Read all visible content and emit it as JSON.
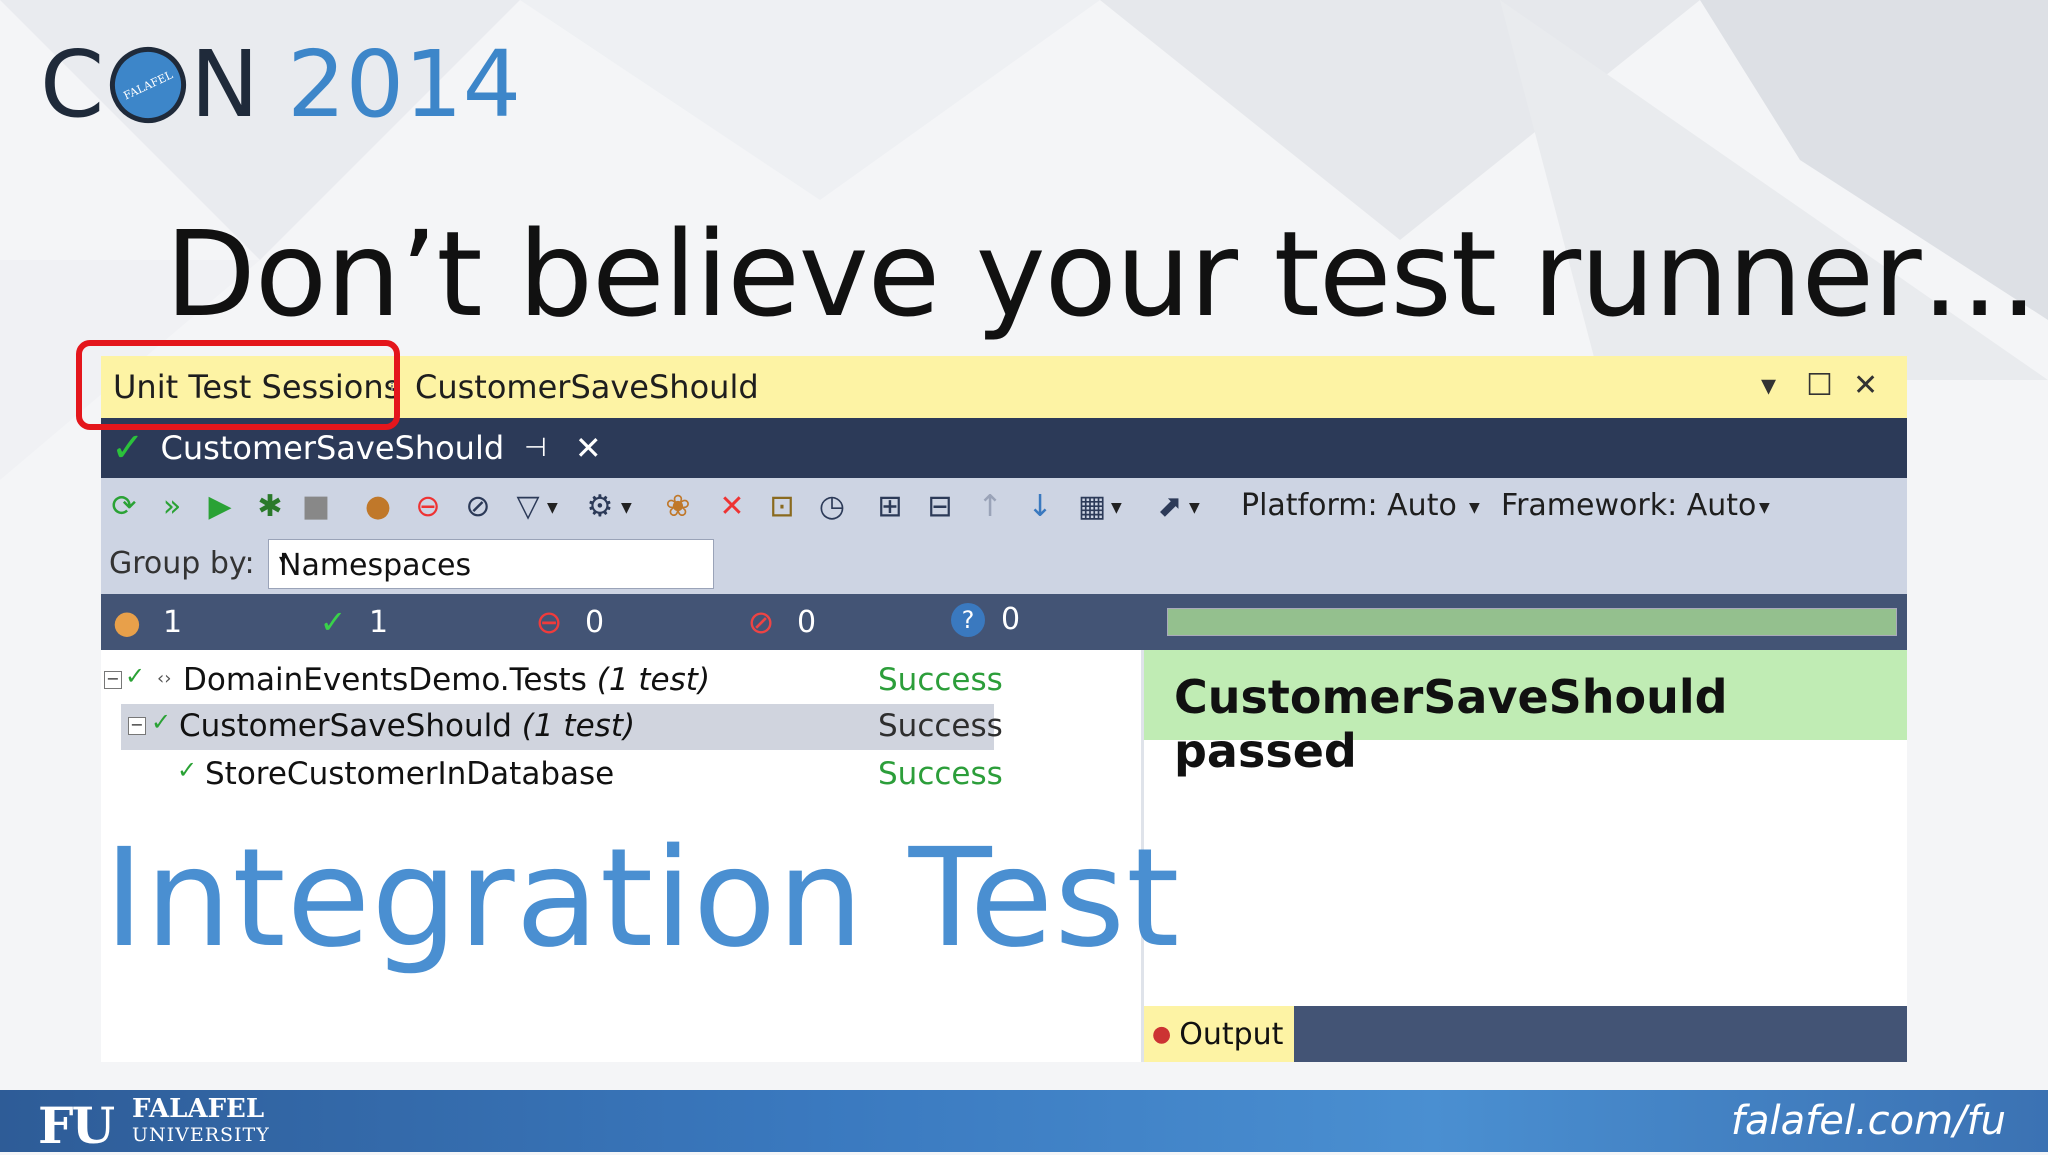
{
  "logo": {
    "c": "C",
    "ring_text": "FALAFEL",
    "n": "N",
    "year": "2014"
  },
  "slide": {
    "title": "Don’t believe your test runner…",
    "overlay": "Integration Test"
  },
  "window": {
    "title": "Unit Test Sessions",
    "session_name": "CustomerSaveShould",
    "controls": {
      "dropdown": "▾",
      "maximize": "☐",
      "close": "✕"
    }
  },
  "tab": {
    "label": "CustomerSaveShould",
    "pin": "⊣",
    "close": "✕"
  },
  "toolbar": {
    "platform": "Platform: Auto",
    "framework": "Framework: Auto",
    "icons": [
      "run-all-icon",
      "run-unit-tests-icon",
      "run-icon",
      "debug-icon",
      "stop-icon",
      "show-all-icon",
      "show-failed-icon",
      "hide-ignored-icon",
      "filter-icon",
      "build-icon",
      "dotcover-icon",
      "remove-icon",
      "lock-icon",
      "timer-icon",
      "expand-all-icon",
      "collapse-all-icon",
      "previous-icon",
      "next-icon",
      "layout-icon",
      "export-icon"
    ]
  },
  "group_by": {
    "label": "Group by:",
    "value": "Namespaces"
  },
  "status": {
    "total": "1",
    "passed": "1",
    "failed": "0",
    "ignored": "0",
    "unknown": "0",
    "progress_fraction": 1.0
  },
  "tree": [
    {
      "name": "DomainEventsDemo.Tests",
      "count": "(1 test)",
      "result": "Success"
    },
    {
      "name": "CustomerSaveShould",
      "count": "(1 test)",
      "result": "Success"
    },
    {
      "name": "StoreCustomerInDatabase",
      "count": "",
      "result": "Success"
    }
  ],
  "result_panel": {
    "banner": "CustomerSaveShould passed",
    "output_tab": "Output"
  },
  "footer": {
    "fu": "FU",
    "falafel": "FALAFEL",
    "university": "UNIVERSITY",
    "site": "falafel.com/fu"
  },
  "colors": {
    "accent_blue": "#4a8fd1",
    "success_green": "#2c9e3a",
    "highlight_red": "#e4161c",
    "panel_navy": "#2c3a58"
  }
}
